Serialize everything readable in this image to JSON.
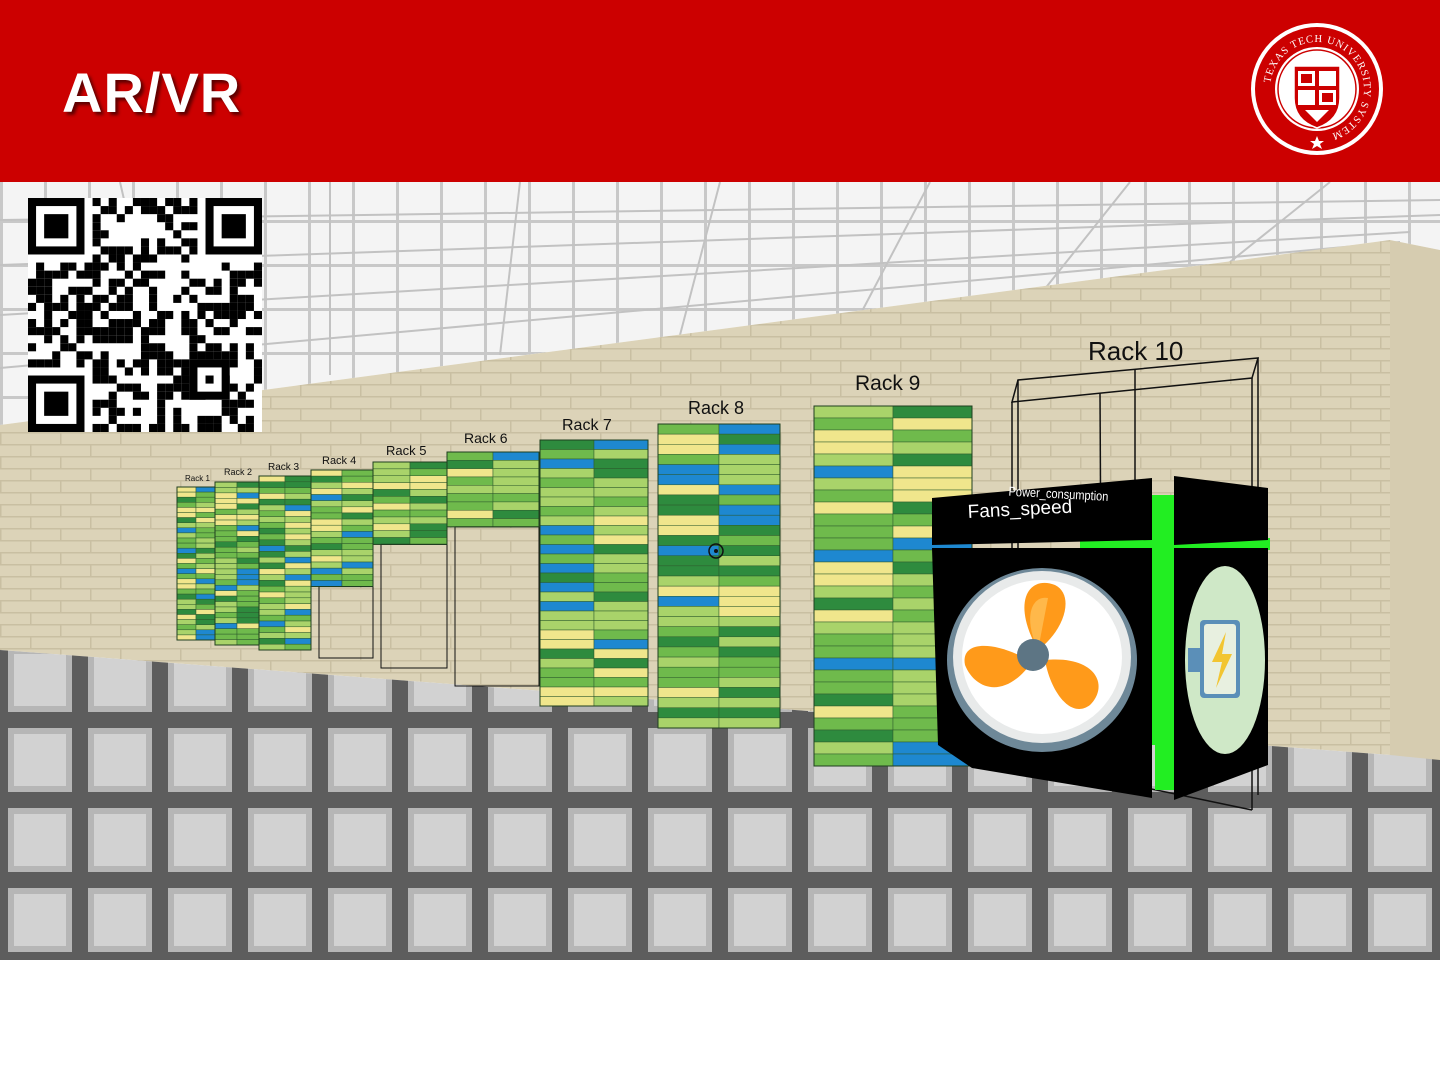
{
  "header": {
    "title": "AR/VR",
    "background_color": "#cc0000",
    "logo": {
      "icon": "texas-tech-university-system-seal",
      "text": "TEXAS TECH UNIVERSITY SYSTEM"
    }
  },
  "qr_code": {
    "icon": "qr-code"
  },
  "scene": {
    "racks": [
      {
        "label": "Rack 1"
      },
      {
        "label": "Rack 2"
      },
      {
        "label": "Rack 3"
      },
      {
        "label": "Rack 4"
      },
      {
        "label": "Rack 5"
      },
      {
        "label": "Rack 6"
      },
      {
        "label": "Rack 7"
      },
      {
        "label": "Rack 8"
      },
      {
        "label": "Rack 9"
      },
      {
        "label": "Rack 10"
      }
    ],
    "panels": {
      "fans": {
        "label": "Fans_speed",
        "icon": "fan-icon"
      },
      "power": {
        "label": "Power_consumption",
        "icon": "battery-charging-icon"
      }
    },
    "colors": {
      "dark_green": "#2e8b3e",
      "green": "#6fba4c",
      "light_green": "#a9d36a",
      "yellow": "#f0e68c",
      "blue": "#1e88d0",
      "highlight": "#22ee22",
      "wall": "#dcd3b8",
      "floor": "#8a8a8a"
    }
  }
}
